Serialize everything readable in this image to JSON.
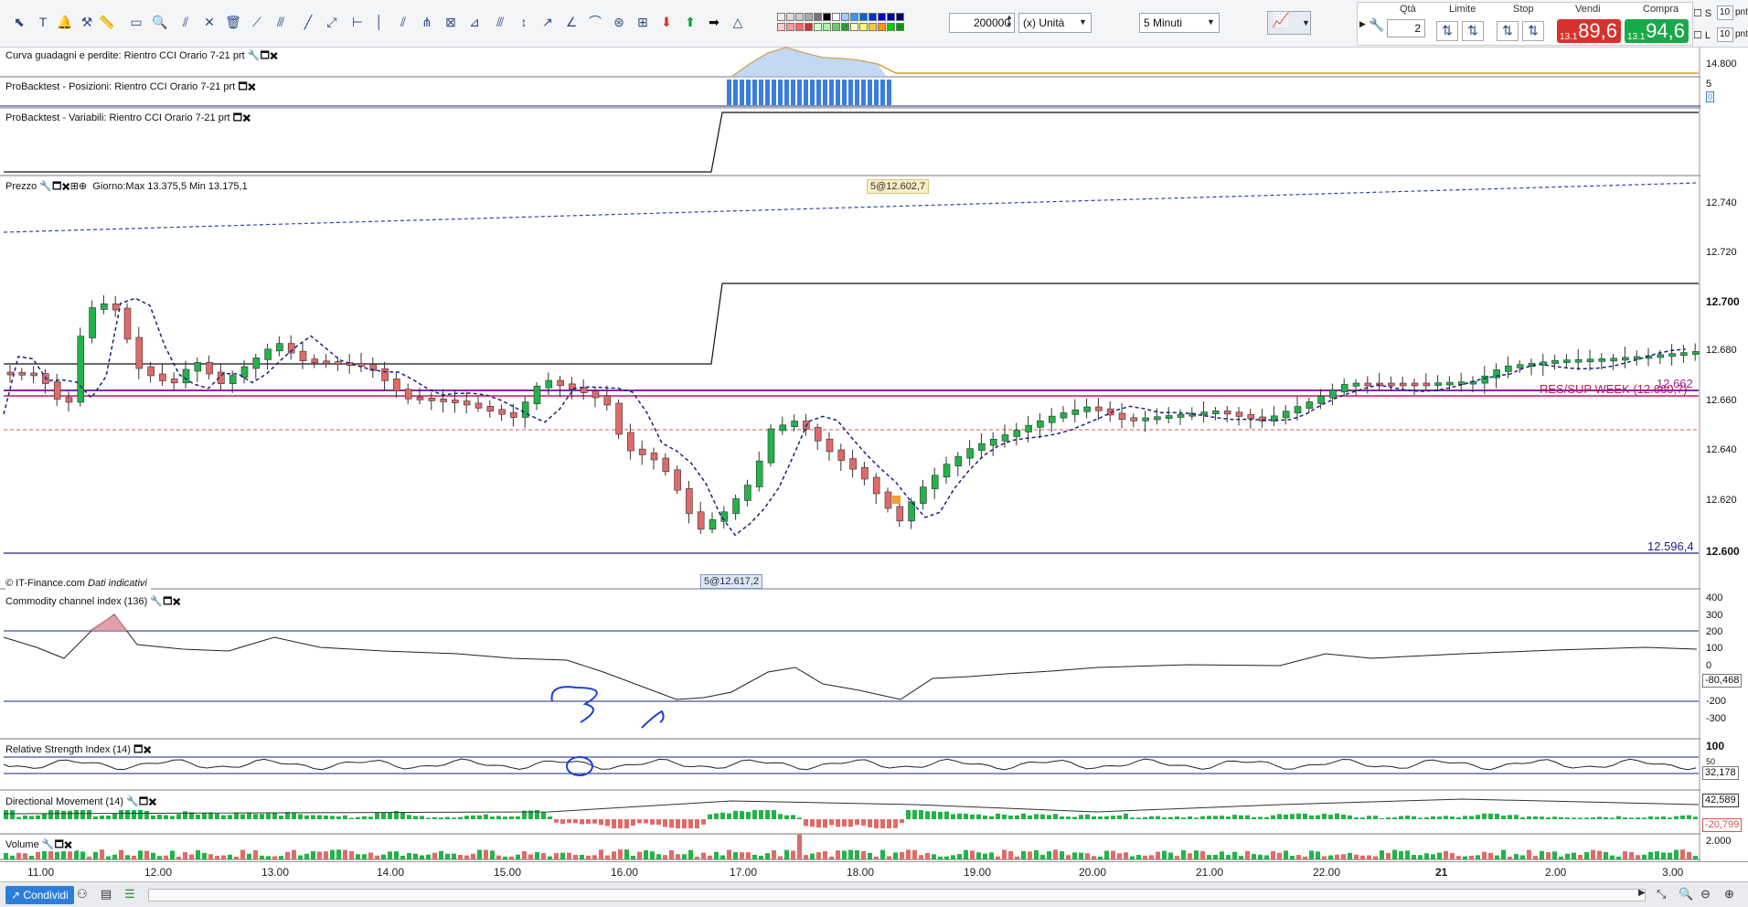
{
  "toolbar": {
    "quantity_value": "200000",
    "unit_select": "(x) Unità",
    "timeframe_select": "5 Minuti"
  },
  "order_panel": {
    "qty_label": "Qtà",
    "qty_value": "2",
    "limit_label": "Limite",
    "stop_label": "Stop",
    "sell_label": "Vendi",
    "buy_label": "Compra",
    "sell_prefix": "13.1",
    "sell_price": "89,6",
    "buy_prefix": "13.1",
    "buy_price": "94,6",
    "s_label": "S",
    "l_label": "L",
    "s_value": "10",
    "l_value": "10",
    "unit": "pnt"
  },
  "panes": {
    "pnl_title": "Curva guadagni e perdite: Rientro CCI Orario 7-21 prt",
    "pnl_axis": "14.800",
    "positions_title": "ProBacktest - Posizioni: Rientro CCI Orario 7-21 prt",
    "positions_axis_top": "5",
    "positions_axis_bottom": "0",
    "variables_title": "ProBacktest - Variabili: Rientro CCI Orario 7-21 prt",
    "price_title": "Prezzo",
    "price_info": "Giorno:Max 13.375,5 Min 13.175,1",
    "price_tag_top": "5@12.602,7",
    "price_tag_bottom": "5@12.617,2",
    "price_low_value": "12.596,4",
    "price_res_value": "12.662",
    "price_res_label": "RES/SUP WEEK (12.660,7)",
    "copyright": "© IT-Finance.com",
    "copyright_note": "Dati indicativi",
    "cci_title": "Commodity channel index (136)",
    "cci_current": "-80,468",
    "rsi_title": "Relative Strength Index (14)",
    "rsi_current": "32,178",
    "rsi_top": "100",
    "rsi_mid": "50",
    "dm_title": "Directional Movement (14)",
    "dm_pos": "42,589",
    "dm_neg": "-20,799",
    "vol_title": "Volume",
    "vol_axis": "2.000"
  },
  "price_axis": [
    "12.740",
    "12.720",
    "12.700",
    "12.680",
    "12.660",
    "12.640",
    "12.620",
    "12.600"
  ],
  "cci_axis": [
    "400",
    "300",
    "200",
    "100",
    "0",
    "-200",
    "-300"
  ],
  "time_axis": [
    "11.00",
    "12.00",
    "13.00",
    "14.00",
    "15.00",
    "16.00",
    "17.00",
    "18.00",
    "19.00",
    "20.00",
    "21.00",
    "22.00",
    "21",
    "2.00",
    "3.00"
  ],
  "statusbar": {
    "share_label": "Condividi"
  },
  "colors": {
    "up": "#22b34a",
    "down": "#d9534f",
    "sell": "#d8322f",
    "buy": "#1aa94a",
    "line": "#1a237e"
  }
}
